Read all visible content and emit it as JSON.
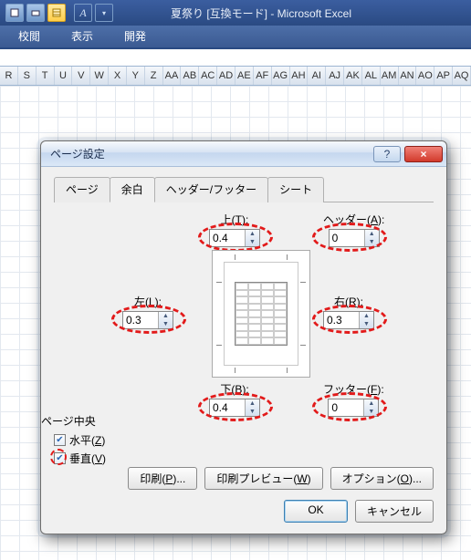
{
  "app": {
    "title": "夏祭り [互換モード] - Microsoft Excel"
  },
  "ribbon": {
    "tabs": [
      "校閲",
      "表示",
      "開発"
    ]
  },
  "columns": [
    "R",
    "S",
    "T",
    "U",
    "V",
    "W",
    "X",
    "Y",
    "Z",
    "AA",
    "AB",
    "AC",
    "AD",
    "AE",
    "AF",
    "AG",
    "AH",
    "AI",
    "AJ",
    "AK",
    "AL",
    "AM",
    "AN",
    "AO",
    "AP",
    "AQ"
  ],
  "dialog": {
    "title": "ページ設定",
    "help_label": "?",
    "close_label": "×",
    "tabs": {
      "page": "ページ",
      "margins": "余白",
      "headerfooter": "ヘッダー/フッター",
      "sheet": "シート"
    },
    "margins": {
      "top": {
        "label_pre": "上(",
        "accel": "T",
        "label_post": "):",
        "value": "0.4"
      },
      "header": {
        "label_pre": "ヘッダー(",
        "accel": "A",
        "label_post": "):",
        "value": "0"
      },
      "left": {
        "label_pre": "左(",
        "accel": "L",
        "label_post": "):",
        "value": "0.3"
      },
      "right": {
        "label_pre": "右(",
        "accel": "R",
        "label_post": "):",
        "value": "0.3"
      },
      "bottom": {
        "label_pre": "下(",
        "accel": "B",
        "label_post": "):",
        "value": "0.4"
      },
      "footer": {
        "label_pre": "フッター(",
        "accel": "F",
        "label_post": "):",
        "value": "0"
      }
    },
    "page_center": {
      "title": "ページ中央",
      "horizontal": {
        "label_pre": "水平(",
        "accel": "Z",
        "label_post": ")",
        "checked": true
      },
      "vertical": {
        "label_pre": "垂直(",
        "accel": "V",
        "label_post": ")",
        "checked": true
      }
    },
    "buttons": {
      "print": {
        "label": "印刷(",
        "accel": "P",
        "post": ")..."
      },
      "preview": {
        "label": "印刷プレビュー(",
        "accel": "W",
        "post": ")"
      },
      "options": {
        "label": "オプション(",
        "accel": "O",
        "post": ")..."
      },
      "ok": "OK",
      "cancel": "キャンセル"
    }
  }
}
